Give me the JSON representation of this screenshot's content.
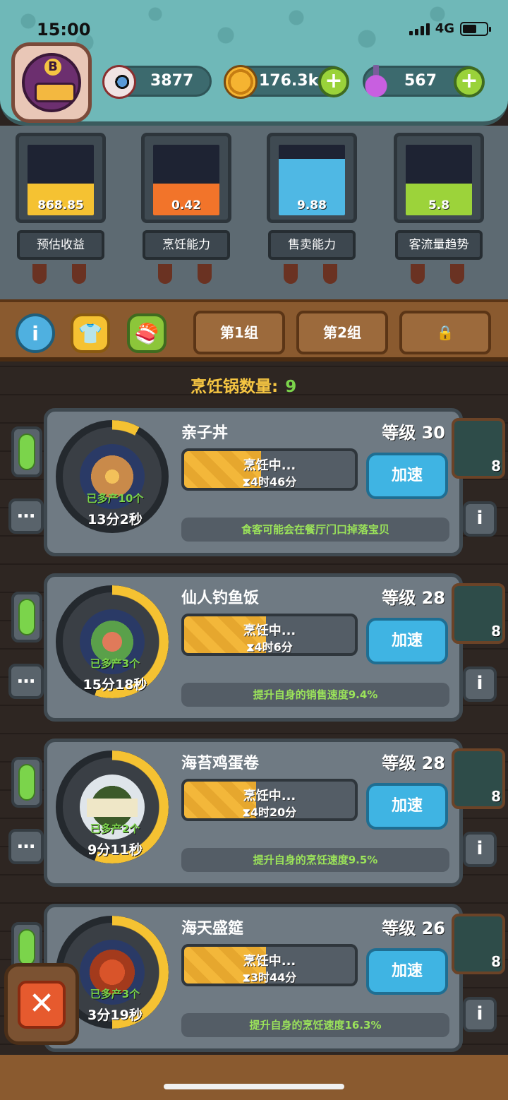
{
  "status_bar": {
    "time": "15:00",
    "network": "4G"
  },
  "currencies": [
    {
      "icon": "eyeball-icon",
      "value": "3877"
    },
    {
      "icon": "coin-icon",
      "value": "176.3k"
    },
    {
      "icon": "potion-icon",
      "value": "567"
    }
  ],
  "stats": [
    {
      "label": "预估收益",
      "value": "868.85",
      "color": "#f5c232",
      "fill": 0.45
    },
    {
      "label": "烹饪能力",
      "value": "0.42",
      "color": "#f2742a",
      "fill": 0.45
    },
    {
      "label": "售卖能力",
      "value": "9.88",
      "color": "#4fb8e4",
      "fill": 0.8
    },
    {
      "label": "客流量趋势",
      "value": "5.8",
      "color": "#9cd33a",
      "fill": 0.45
    }
  ],
  "toolbar": {
    "group1": "第1组",
    "group2": "第2组",
    "info_icon": "i",
    "lock_icon": "🔒"
  },
  "pot_count": {
    "label": "烹饪锅数量:",
    "value": "9"
  },
  "cooking_status": "烹饪中...",
  "speed_label": "加速",
  "dishes": [
    {
      "name": "亲子丼",
      "level": "等级 30",
      "extra": "已多产10个",
      "timer": "13分2秒",
      "cook_time": "⧗4时46分",
      "effect": "食客可能会在餐厅门口掉落宝贝",
      "cook_progress": 0.45,
      "ring_progress": 0.08,
      "book": "8"
    },
    {
      "name": "仙人钓鱼饭",
      "level": "等级 28",
      "extra": "已多产3个",
      "timer": "15分18秒",
      "cook_time": "⧗4时6分",
      "effect": "提升自身的销售速度9.4%",
      "cook_progress": 0.48,
      "ring_progress": 0.55,
      "book": "8"
    },
    {
      "name": "海苔鸡蛋卷",
      "level": "等级 28",
      "extra": "已多产2个",
      "timer": "9分11秒",
      "cook_time": "⧗4时20分",
      "effect": "提升自身的烹饪速度9.5%",
      "cook_progress": 0.42,
      "ring_progress": 0.55,
      "book": "8"
    },
    {
      "name": "海天盛筵",
      "level": "等级 26",
      "extra": "已多产3个",
      "timer": "3分19秒",
      "cook_time": "⧗3时44分",
      "effect": "提升自身的烹饪速度16.3%",
      "cook_progress": 0.48,
      "ring_progress": 0.5,
      "book": "8"
    }
  ]
}
